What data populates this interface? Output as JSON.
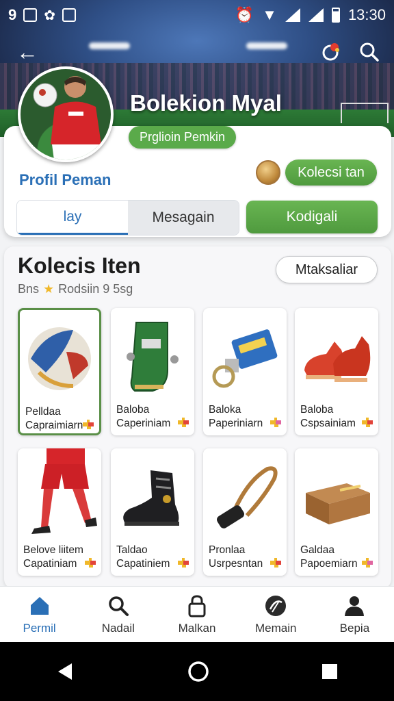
{
  "status_bar": {
    "left_number": "9",
    "time": "13:30"
  },
  "header": {
    "title": "Bolekion Myal",
    "pill": "Prglioin Pemkin"
  },
  "profile": {
    "label": "Profil Peman",
    "collect_button": "Kolecsi tan"
  },
  "tabs": [
    {
      "label": "lay",
      "active": true
    },
    {
      "label": "Mesagain",
      "active": false
    }
  ],
  "action_button": "Kodigali",
  "collection": {
    "title": "Kolecis Iten",
    "subtitle_left": "Bns",
    "subtitle_right": "Rodsiin 9 5sg",
    "filter_button": "Mtaksaliar",
    "items": [
      {
        "line1": "Pelldaa",
        "line2": "Capraimiarn",
        "art": "soccer-ball",
        "selected": true
      },
      {
        "line1": "Baloba",
        "line2": "Caperiniam",
        "art": "green-boot"
      },
      {
        "line1": "Baloka",
        "line2": "Paperiniarn",
        "art": "keychain"
      },
      {
        "line1": "Baloba",
        "line2": "Cspsainiam",
        "art": "red-boots"
      },
      {
        "line1": "Belove liitem",
        "line2": "Capatiniam",
        "art": "player-legs"
      },
      {
        "line1": "Taldao",
        "line2": "Capatiniem",
        "art": "black-cleat"
      },
      {
        "line1": "Pronlaa",
        "line2": "Usrpesntan",
        "art": "lanyard"
      },
      {
        "line1": "Galdaa",
        "line2": "Papoemiarn",
        "art": "wood-box"
      }
    ]
  },
  "bottom_nav": [
    {
      "label": "Permil",
      "icon": "home-icon",
      "active": true
    },
    {
      "label": "Nadail",
      "icon": "search-icon"
    },
    {
      "label": "Malkan",
      "icon": "lock-icon"
    },
    {
      "label": "Memain",
      "icon": "globe-icon"
    },
    {
      "label": "Bepia",
      "icon": "person-icon"
    }
  ],
  "colors": {
    "accent_blue": "#2a6fb6",
    "accent_green": "#5aaa4a"
  }
}
